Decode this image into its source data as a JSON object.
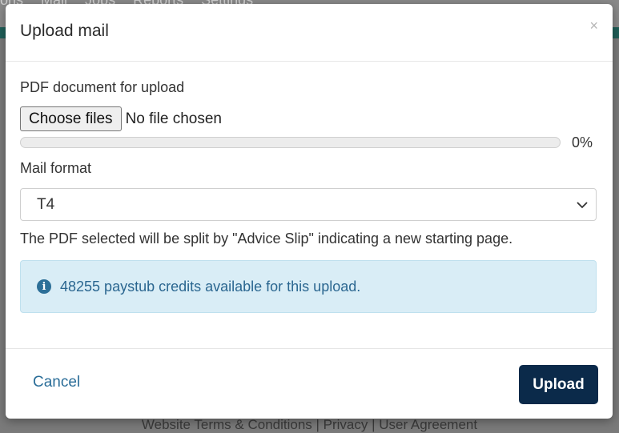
{
  "background": {
    "nav_items": [
      "ons",
      "Mail",
      "Jobs",
      "Reports",
      "Settings"
    ],
    "footer_text": "Website Terms & Conditions | Privacy | User Agreement"
  },
  "modal": {
    "title": "Upload mail",
    "close_glyph": "×",
    "pdf_label": "PDF document for upload",
    "file_input": {
      "button_label": "Choose files",
      "status": "No file chosen"
    },
    "progress": {
      "value": 0,
      "label": "0%"
    },
    "format_label": "Mail format",
    "format_select": {
      "selected": "T4"
    },
    "help_text": "The PDF selected will be split by \"Advice Slip\" indicating a new starting page.",
    "alert": {
      "icon": "info-circle-icon",
      "text": "48255 paystub credits available for this upload."
    },
    "footer": {
      "cancel_label": "Cancel",
      "upload_label": "Upload"
    }
  },
  "colors": {
    "primary": "#0b2a4a",
    "link": "#2a6d98",
    "alert_bg": "#d9edf6",
    "alert_text": "#2a6690"
  }
}
